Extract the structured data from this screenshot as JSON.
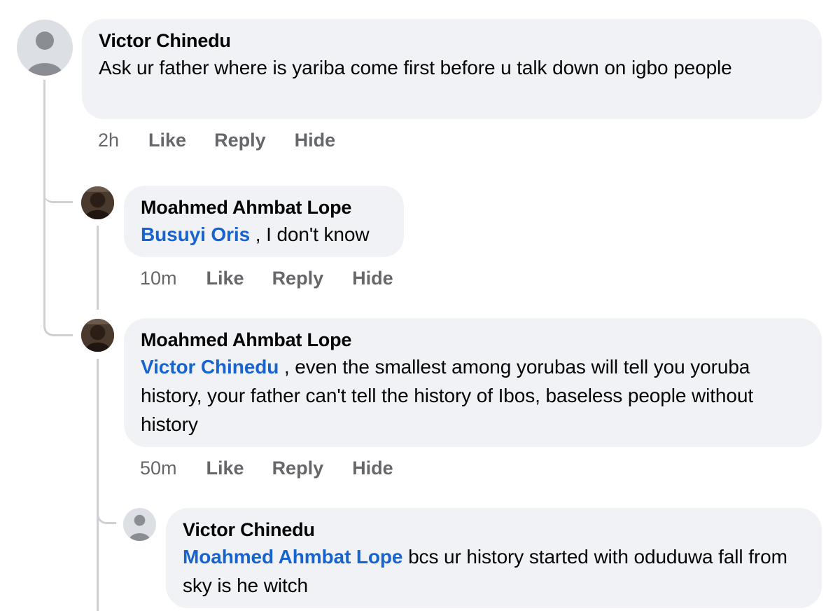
{
  "comments": [
    {
      "author": "Victor Chinedu",
      "text": "Ask ur father where is yariba come first before u talk down on igbo people",
      "time": "2h",
      "actions": [
        "Like",
        "Reply",
        "Hide"
      ]
    },
    {
      "author": "Moahmed Ahmbat Lope",
      "mention": "Busuyi Oris",
      "text": " , I don't know",
      "time": "10m",
      "actions": [
        "Like",
        "Reply",
        "Hide"
      ]
    },
    {
      "author": "Moahmed Ahmbat Lope",
      "mention": "Victor Chinedu",
      "text": " , even the smallest among yorubas will tell you yoruba history, your father can't tell the history of Ibos, baseless people without history",
      "time": "50m",
      "actions": [
        "Like",
        "Reply",
        "Hide"
      ]
    },
    {
      "author": "Victor Chinedu",
      "mention": "Moahmed Ahmbat Lope",
      "text": " bcs ur history started with oduduwa fall from sky is he witch"
    }
  ],
  "icons": {
    "default_avatar": "default-avatar-icon",
    "profile_photo": "profile-photo"
  },
  "colors": {
    "bubble": "#f0f2f5",
    "mention": "#1763cf",
    "meta": "#65676b",
    "thread_line": "#ced0d4"
  }
}
